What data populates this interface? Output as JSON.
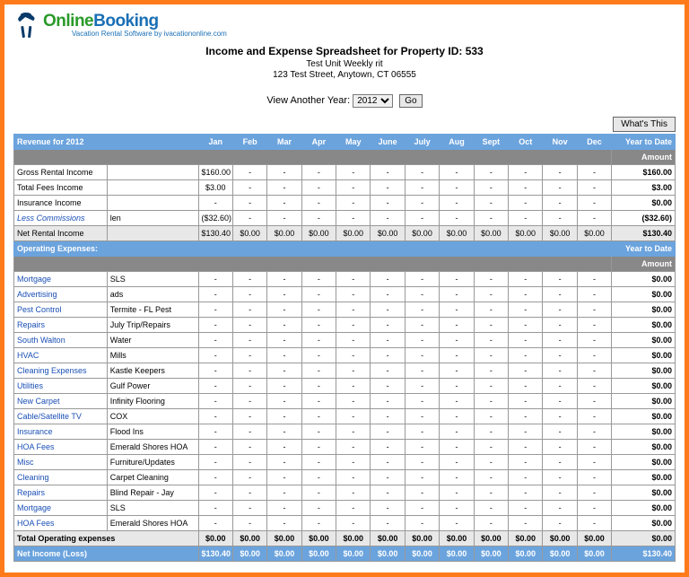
{
  "logo": {
    "part1": "Online",
    "part2": "Booking",
    "tagline": "Vacation Rental Software by ivacationonline.com"
  },
  "header": {
    "title": "Income and Expense Spreadsheet for Property ID: 533",
    "unit": "Test Unit Weekly rit",
    "address": "123 Test Street, Anytown, CT 06555"
  },
  "year_selector": {
    "label": "View Another Year:",
    "value": "2012",
    "go": "Go"
  },
  "whats_this": "What's This",
  "months": [
    "Jan",
    "Feb",
    "Mar",
    "Apr",
    "May",
    "June",
    "July",
    "Aug",
    "Sept",
    "Oct",
    "Nov",
    "Dec"
  ],
  "ytd_label": "Year to Date",
  "amount_label": "Amount",
  "revenue": {
    "header": "Revenue for 2012",
    "rows": [
      {
        "label": "Gross Rental Income",
        "desc": "",
        "vals": [
          "$160.00",
          "-",
          "-",
          "-",
          "-",
          "-",
          "-",
          "-",
          "-",
          "-",
          "-",
          "-"
        ],
        "ytd": "$160.00"
      },
      {
        "label": "Total Fees Income",
        "desc": "",
        "vals": [
          "$3.00",
          "-",
          "-",
          "-",
          "-",
          "-",
          "-",
          "-",
          "-",
          "-",
          "-",
          "-"
        ],
        "ytd": "$3.00"
      },
      {
        "label": "Insurance Income",
        "desc": "",
        "vals": [
          "-",
          "-",
          "-",
          "-",
          "-",
          "-",
          "-",
          "-",
          "-",
          "-",
          "-",
          "-"
        ],
        "ytd": "$0.00"
      },
      {
        "label": "Less Commissions",
        "italic": true,
        "desc": "len",
        "vals": [
          "($32.60)",
          "-",
          "-",
          "-",
          "-",
          "-",
          "-",
          "-",
          "-",
          "-",
          "-",
          "-"
        ],
        "ytd": "($32.60)"
      },
      {
        "label": "Net Rental Income",
        "desc": "",
        "shaded": true,
        "vals": [
          "$130.40",
          "$0.00",
          "$0.00",
          "$0.00",
          "$0.00",
          "$0.00",
          "$0.00",
          "$0.00",
          "$0.00",
          "$0.00",
          "$0.00",
          "$0.00"
        ],
        "ytd": "$130.40"
      }
    ]
  },
  "expenses": {
    "header": "Operating Expenses:",
    "rows": [
      {
        "label": "Mortgage",
        "link": true,
        "desc": "SLS",
        "vals": [
          "-",
          "-",
          "-",
          "-",
          "-",
          "-",
          "-",
          "-",
          "-",
          "-",
          "-",
          "-"
        ],
        "ytd": "$0.00"
      },
      {
        "label": "Advertising",
        "link": true,
        "desc": "ads",
        "vals": [
          "-",
          "-",
          "-",
          "-",
          "-",
          "-",
          "-",
          "-",
          "-",
          "-",
          "-",
          "-"
        ],
        "ytd": "$0.00"
      },
      {
        "label": "Pest Control",
        "link": true,
        "desc": "Termite - FL Pest",
        "vals": [
          "-",
          "-",
          "-",
          "-",
          "-",
          "-",
          "-",
          "-",
          "-",
          "-",
          "-",
          "-"
        ],
        "ytd": "$0.00"
      },
      {
        "label": "Repairs",
        "link": true,
        "desc": "July Trip/Repairs",
        "vals": [
          "-",
          "-",
          "-",
          "-",
          "-",
          "-",
          "-",
          "-",
          "-",
          "-",
          "-",
          "-"
        ],
        "ytd": "$0.00"
      },
      {
        "label": "South Walton",
        "link": true,
        "desc": "Water",
        "vals": [
          "-",
          "-",
          "-",
          "-",
          "-",
          "-",
          "-",
          "-",
          "-",
          "-",
          "-",
          "-"
        ],
        "ytd": "$0.00"
      },
      {
        "label": "HVAC",
        "link": true,
        "desc": "Mills",
        "vals": [
          "-",
          "-",
          "-",
          "-",
          "-",
          "-",
          "-",
          "-",
          "-",
          "-",
          "-",
          "-"
        ],
        "ytd": "$0.00"
      },
      {
        "label": "Cleaning Expenses",
        "link": true,
        "desc": "Kastle Keepers",
        "vals": [
          "-",
          "-",
          "-",
          "-",
          "-",
          "-",
          "-",
          "-",
          "-",
          "-",
          "-",
          "-"
        ],
        "ytd": "$0.00"
      },
      {
        "label": "Utilities",
        "link": true,
        "desc": "Gulf Power",
        "vals": [
          "-",
          "-",
          "-",
          "-",
          "-",
          "-",
          "-",
          "-",
          "-",
          "-",
          "-",
          "-"
        ],
        "ytd": "$0.00"
      },
      {
        "label": "New Carpet",
        "link": true,
        "desc": "Infinity Flooring",
        "vals": [
          "-",
          "-",
          "-",
          "-",
          "-",
          "-",
          "-",
          "-",
          "-",
          "-",
          "-",
          "-"
        ],
        "ytd": "$0.00"
      },
      {
        "label": "Cable/Satellite TV",
        "link": true,
        "desc": "COX",
        "vals": [
          "-",
          "-",
          "-",
          "-",
          "-",
          "-",
          "-",
          "-",
          "-",
          "-",
          "-",
          "-"
        ],
        "ytd": "$0.00"
      },
      {
        "label": "Insurance",
        "link": true,
        "desc": "Flood Ins",
        "vals": [
          "-",
          "-",
          "-",
          "-",
          "-",
          "-",
          "-",
          "-",
          "-",
          "-",
          "-",
          "-"
        ],
        "ytd": "$0.00"
      },
      {
        "label": "HOA Fees",
        "link": true,
        "desc": "Emerald Shores HOA",
        "vals": [
          "-",
          "-",
          "-",
          "-",
          "-",
          "-",
          "-",
          "-",
          "-",
          "-",
          "-",
          "-"
        ],
        "ytd": "$0.00"
      },
      {
        "label": "Misc",
        "link": true,
        "desc": "Furniture/Updates",
        "vals": [
          "-",
          "-",
          "-",
          "-",
          "-",
          "-",
          "-",
          "-",
          "-",
          "-",
          "-",
          "-"
        ],
        "ytd": "$0.00"
      },
      {
        "label": "Cleaning",
        "link": true,
        "desc": "Carpet Cleaning",
        "vals": [
          "-",
          "-",
          "-",
          "-",
          "-",
          "-",
          "-",
          "-",
          "-",
          "-",
          "-",
          "-"
        ],
        "ytd": "$0.00"
      },
      {
        "label": "Repairs",
        "link": true,
        "desc": "Blind Repair - Jay",
        "vals": [
          "-",
          "-",
          "-",
          "-",
          "-",
          "-",
          "-",
          "-",
          "-",
          "-",
          "-",
          "-"
        ],
        "ytd": "$0.00"
      },
      {
        "label": "Mortgage",
        "link": true,
        "desc": "SLS",
        "vals": [
          "-",
          "-",
          "-",
          "-",
          "-",
          "-",
          "-",
          "-",
          "-",
          "-",
          "-",
          "-"
        ],
        "ytd": "$0.00"
      },
      {
        "label": "HOA Fees",
        "link": true,
        "desc": "Emerald Shores HOA",
        "vals": [
          "-",
          "-",
          "-",
          "-",
          "-",
          "-",
          "-",
          "-",
          "-",
          "-",
          "-",
          "-"
        ],
        "ytd": "$0.00"
      }
    ],
    "total": {
      "label": "Total Operating expenses",
      "vals": [
        "$0.00",
        "$0.00",
        "$0.00",
        "$0.00",
        "$0.00",
        "$0.00",
        "$0.00",
        "$0.00",
        "$0.00",
        "$0.00",
        "$0.00",
        "$0.00"
      ],
      "ytd": "$0.00"
    },
    "net": {
      "label": "Net Income (Loss)",
      "vals": [
        "$130.40",
        "$0.00",
        "$0.00",
        "$0.00",
        "$0.00",
        "$0.00",
        "$0.00",
        "$0.00",
        "$0.00",
        "$0.00",
        "$0.00",
        "$0.00"
      ],
      "ytd": "$130.40"
    }
  }
}
